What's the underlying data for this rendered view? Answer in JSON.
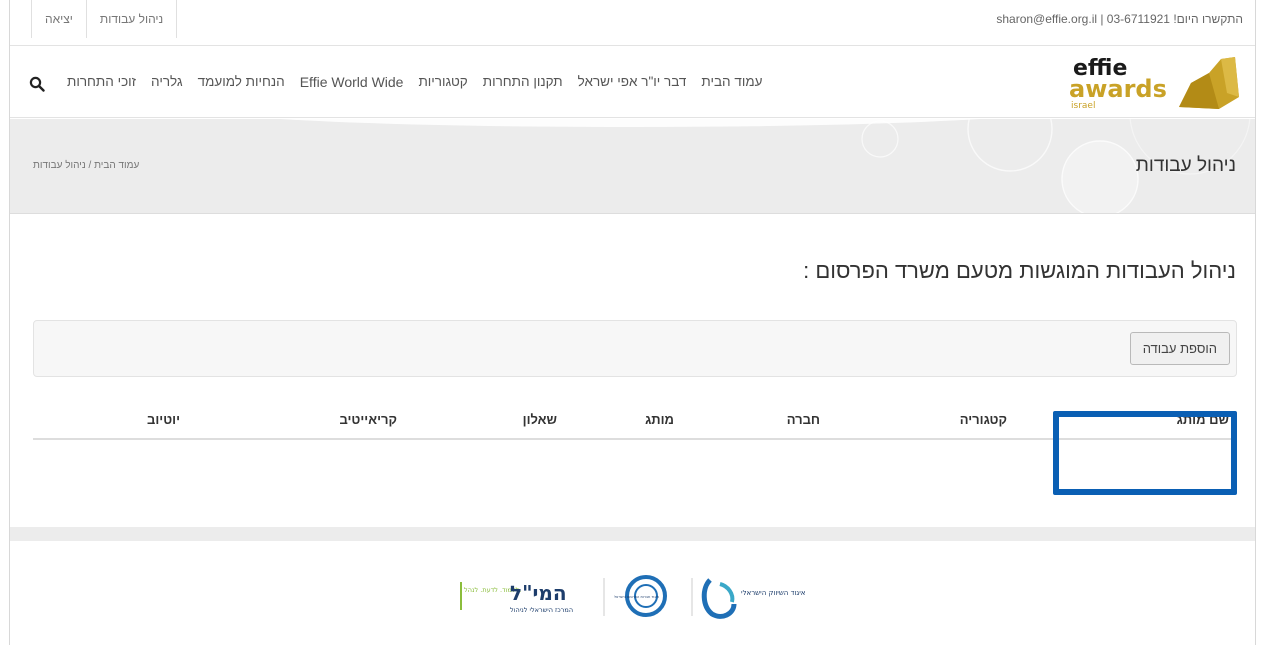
{
  "topbar": {
    "links": [
      "יציאה",
      "ניהול עבודות"
    ],
    "contact": "sharon@effie.org.il  |  03-6711921 !התקשרו היום"
  },
  "nav": {
    "items": [
      "זוכי התחרות",
      "גלריה",
      "הנחיות למועמד",
      "Effie World Wide",
      "קטגוריות",
      "תקנון התחרות",
      "דבר יו\"ר אפי ישראל",
      "עמוד הבית"
    ]
  },
  "logo": {
    "line1": "effie",
    "line2": "awards",
    "line3": "israel"
  },
  "titleband": {
    "title": "ניהול עבודות",
    "breadcrumb": "עמוד הבית / ניהול עבודות"
  },
  "main": {
    "heading": "ניהול העבודות המוגשות מטעם משרד הפרסום :",
    "add_button": "הוספת עבודה",
    "columns": [
      "שם מותג",
      "קטגוריה",
      "חברה",
      "מותג",
      "שאלון",
      "קריאייטיב",
      "יוטיוב"
    ]
  },
  "footer": {
    "partner1": "איגוד השיווק הישראלי",
    "partner2": "איגוד חברות הפרסום בישראל",
    "partner3_title": "המי\"ל",
    "partner3_sub": "המרכז הישראלי לניהול",
    "partner3_tag": "ללמוד. לדעת. לנהל."
  },
  "colors": {
    "accent": "#0a5fb4",
    "logo_gold": "#c9a227",
    "partner_green": "#8bbd3c"
  }
}
